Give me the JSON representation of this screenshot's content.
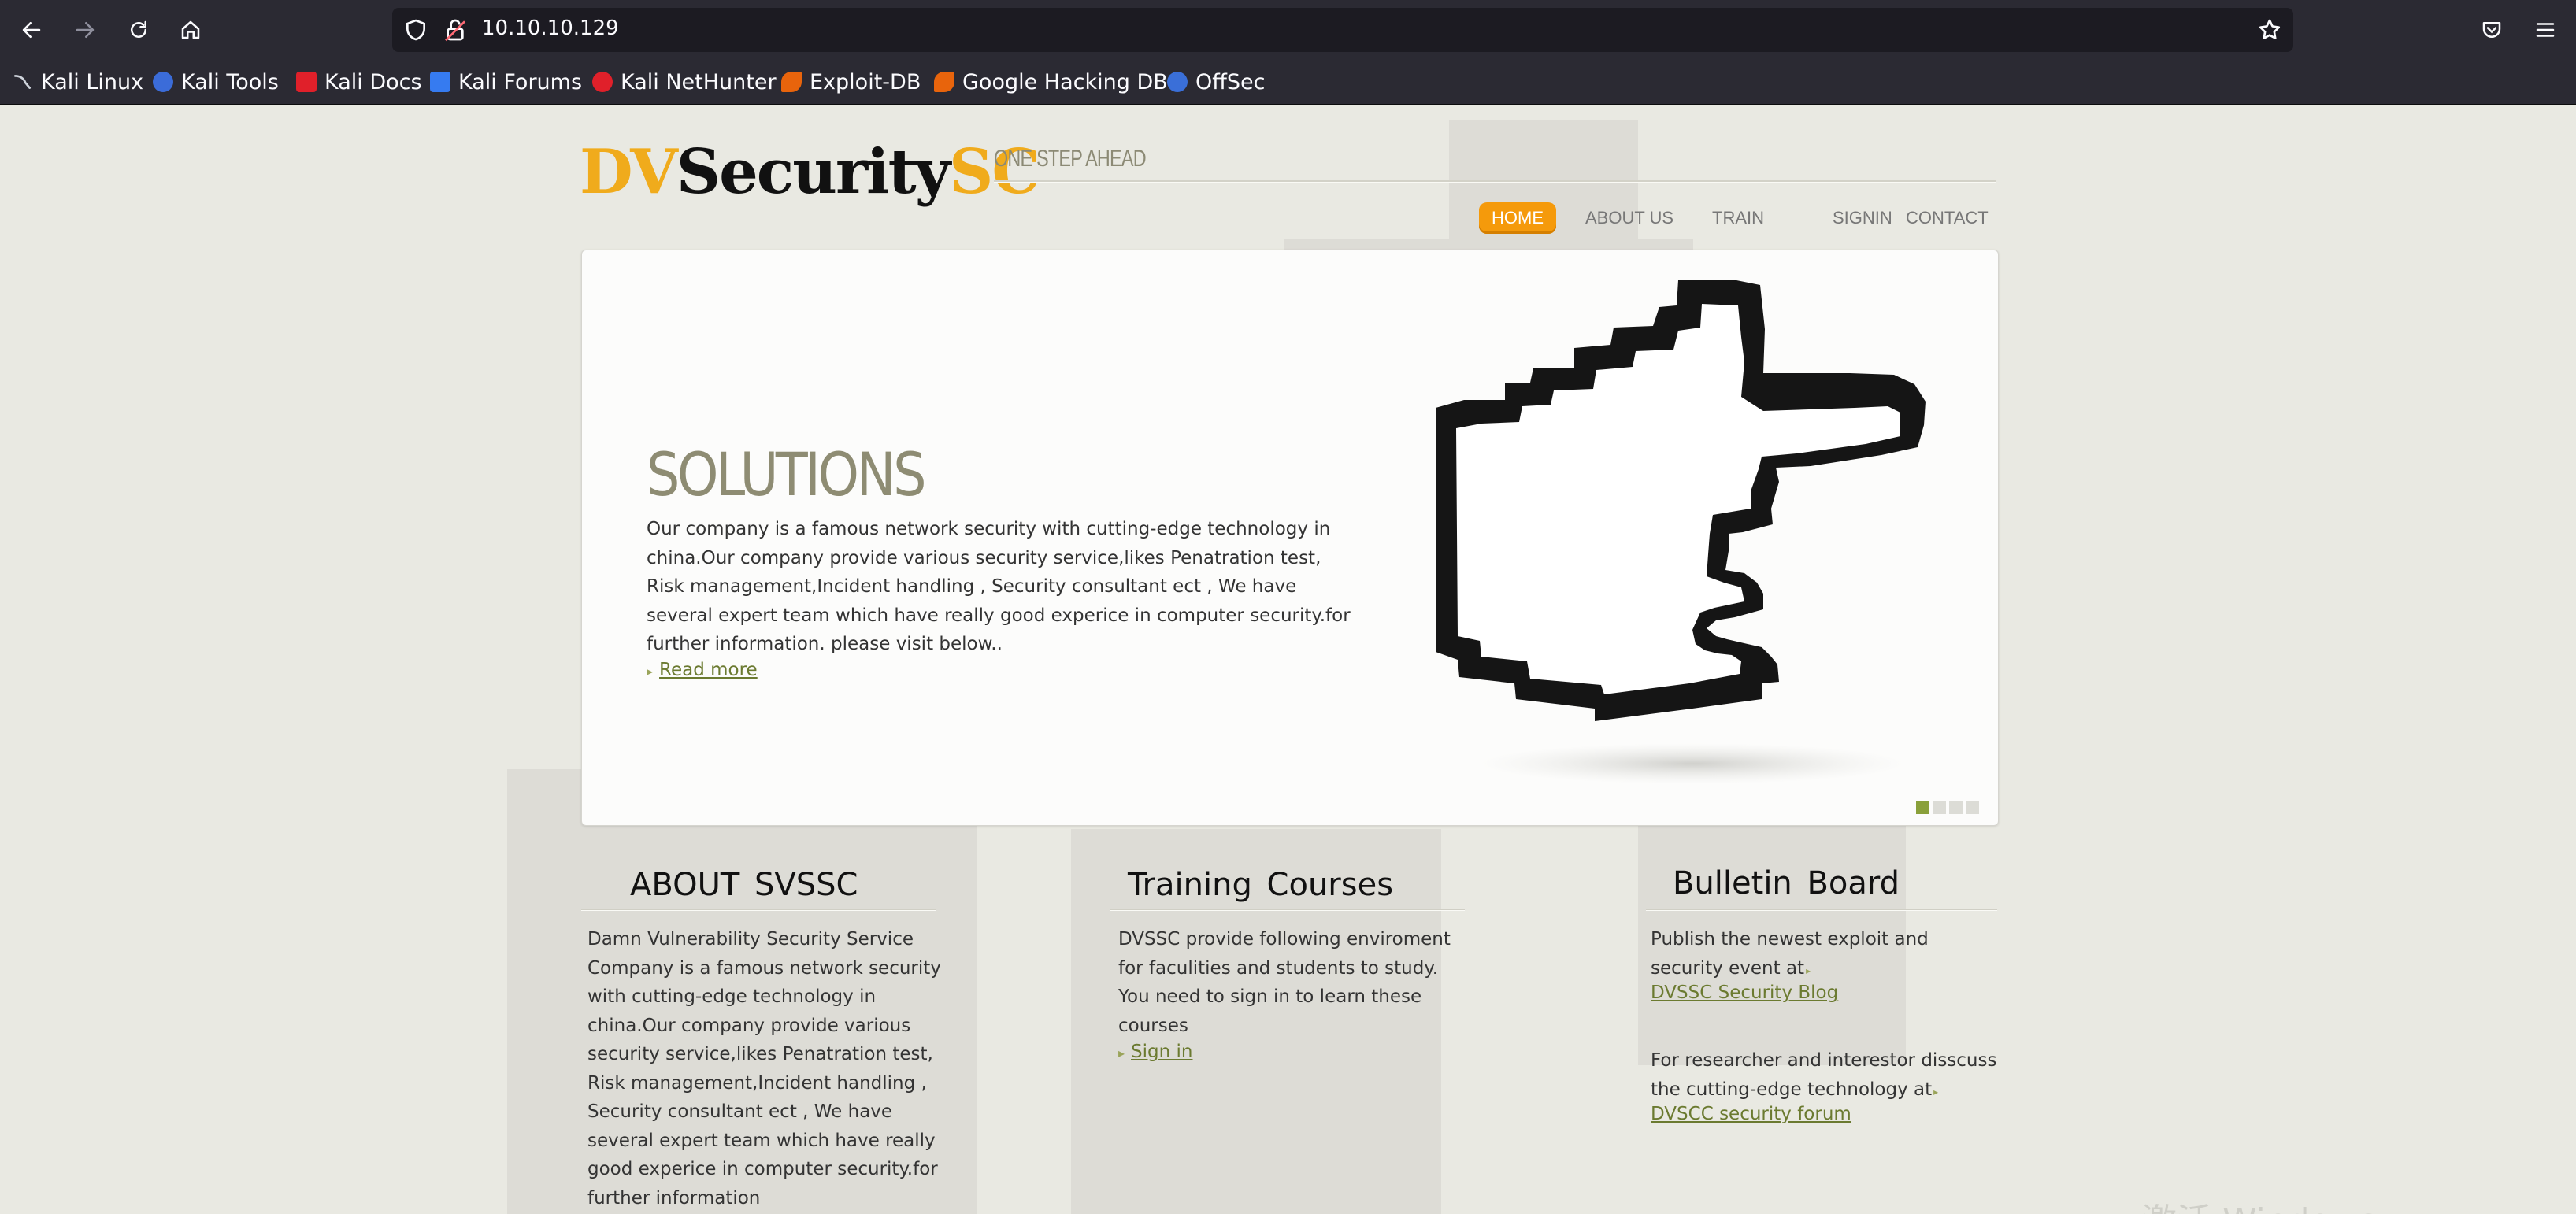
{
  "browser": {
    "url": "10.10.10.129",
    "bookmarks": [
      {
        "label": "Kali Linux",
        "icon": "kali-dragon-icon",
        "color": "#367bf0"
      },
      {
        "label": "Kali Tools",
        "icon": "kali-tools-icon",
        "color": "#3b6cd9"
      },
      {
        "label": "Kali Docs",
        "icon": "kali-docs-icon",
        "color": "#e0202a"
      },
      {
        "label": "Kali Forums",
        "icon": "kali-forums-icon",
        "color": "#367bf0"
      },
      {
        "label": "Kali NetHunter",
        "icon": "kali-nethunter-icon",
        "color": "#e0202a"
      },
      {
        "label": "Exploit-DB",
        "icon": "exploit-db-icon",
        "color": "#e8640c"
      },
      {
        "label": "Google Hacking DB",
        "icon": "google-hacking-db-icon",
        "color": "#e8640c"
      },
      {
        "label": "OffSec",
        "icon": "offsec-icon",
        "color": "#3a6fd8"
      }
    ]
  },
  "site": {
    "logo_dv": "DV",
    "logo_security": "Security",
    "logo_sc": "SC",
    "tagline": "ONE STEP AHEAD",
    "accent_color": "#f59a0b",
    "menu": [
      {
        "label": "HOME",
        "active": true
      },
      {
        "label": "ABOUT US",
        "active": false
      },
      {
        "label": "TRAIN",
        "active": false
      },
      {
        "label": "SIGNIN",
        "active": false
      },
      {
        "label": "CONTACT",
        "active": false
      }
    ]
  },
  "banner": {
    "title": "SOLUTIONS",
    "text": "Our company is a famous network security with cutting-edge technology in china.Our company provide various security service,likes Penatration test, Risk management,Incident handling , Security consultant ect , We have several expert team which have really good experice in computer security.for further information. please visit below..",
    "more": "Read more",
    "image_icon": "pixel-pointing-hand-icon",
    "slides": 4,
    "active_slide": 1
  },
  "about": {
    "heading": "ABOUT  SVSSC",
    "text": "Damn Vulnerability Security Service Company is a famous network security with cutting-edge technology in china.Our company provide various security service,likes Penatration test, Risk management,Incident handling , Security consultant ect , We have several expert team which have really good experice in computer security.for further information"
  },
  "training": {
    "heading": "Training Courses",
    "text": "DVSSC provide following enviroment for faculities and students to study. You need to sign in to learn these courses",
    "link": "Sign in"
  },
  "bulletin": {
    "heading": "Bulletin  Board",
    "text1": "Publish the newest exploit and security event at",
    "link1": "DVSSC Security Blog",
    "text2": "For researcher and interestor disscuss the cutting-edge technology at",
    "link2": "DVSCC security forum"
  },
  "watermark": "激活 Windows"
}
